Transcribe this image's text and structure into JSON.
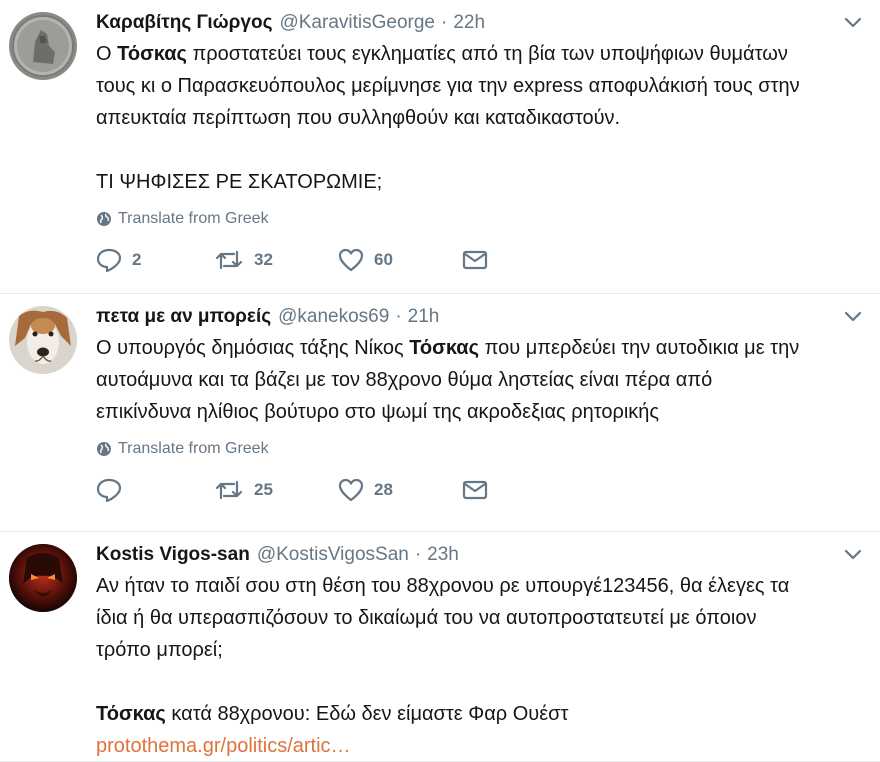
{
  "tweets": [
    {
      "name": "Καραβίτης Γιώργος",
      "handle": "@KaravitisGeorge",
      "dot": "·",
      "time": "22h",
      "text": {
        "l1_a": "Ο ",
        "l1_b": "Τόσκας",
        "l1_c": " προστατεύει τους εγκληματίες από τη βία των υποψήφιων θυμάτων",
        "l2": "τους κι ο Παρασκευόπουλος μερίμνησε για την express αποφυλάκισή τους στην",
        "l3": "απευκταία περίπτωση που συλληφθούν και καταδικαστούν.",
        "l4": "ΤΙ ΨΗΦΙΣΕΣ ΡΕ ΣΚΑΤΟΡΩΜΙΕ;"
      },
      "translate": "Translate from Greek",
      "replies": "2",
      "retweets": "32",
      "likes": "60"
    },
    {
      "name": "πετα με αν μπορείς",
      "handle": "@kanekos69",
      "dot": "·",
      "time": "21h",
      "text": {
        "l1_a": "Ο υπουργός δημόσιας τάξης Νίκος ",
        "l1_b": "Τόσκας",
        "l1_c": " που μπερδεύει την αυτοδικια με την",
        "l2": "αυτοάμυνα και τα βάζει με τον 88χρονο θύμα ληστείας είναι πέρα από",
        "l3": "επικίνδυνα ηλίθιος βούτυρο στο ψωμί της ακροδεξιας ρητορικής"
      },
      "translate": "Translate from Greek",
      "retweets": "25",
      "likes": "28"
    },
    {
      "name": "Kostis Vigos-san",
      "handle": "@KostisVigosSan",
      "dot": "·",
      "time": "23h",
      "text": {
        "l1": "Αν ήταν το παιδί σου στη θέση του 88χρονου ρε υπουργέ123456, θα έλεγες τα",
        "l2": "ίδια ή θα υπερασπιζόσουν το δικαίωμά του να αυτοπροστατευτεί με όποιον",
        "l3": "τρόπο μπορεί;",
        "l4_a": "Τόσκας",
        "l4_b": " κατά 88χρονου: Εδώ δεν είμαστε Φαρ Ουέστ",
        "link": "protothema.gr/politics/artic…"
      }
    }
  ],
  "colors": {
    "text": "#14171a",
    "muted": "#657786",
    "divider": "#e6ecf0",
    "link": "#e0723b"
  },
  "icons": [
    "chevron-down-icon",
    "globe-icon",
    "reply-icon",
    "retweet-icon",
    "like-icon",
    "message-icon"
  ]
}
